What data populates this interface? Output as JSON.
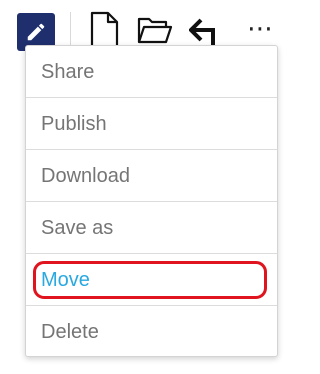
{
  "toolbar": {
    "icons": [
      "pencil-icon",
      "new-document-icon",
      "open-folder-icon",
      "back-arrow-icon",
      "more-icon"
    ],
    "more_label": "⋯",
    "edit_button_color": "#1f2f6e"
  },
  "menu": {
    "items": [
      {
        "label": "Share"
      },
      {
        "label": "Publish"
      },
      {
        "label": "Download"
      },
      {
        "label": "Save as"
      },
      {
        "label": "Move",
        "active": true
      },
      {
        "label": "Delete"
      }
    ],
    "active_color": "#29a9e0",
    "text_color": "#757575",
    "highlight_color": "#e0141e"
  }
}
